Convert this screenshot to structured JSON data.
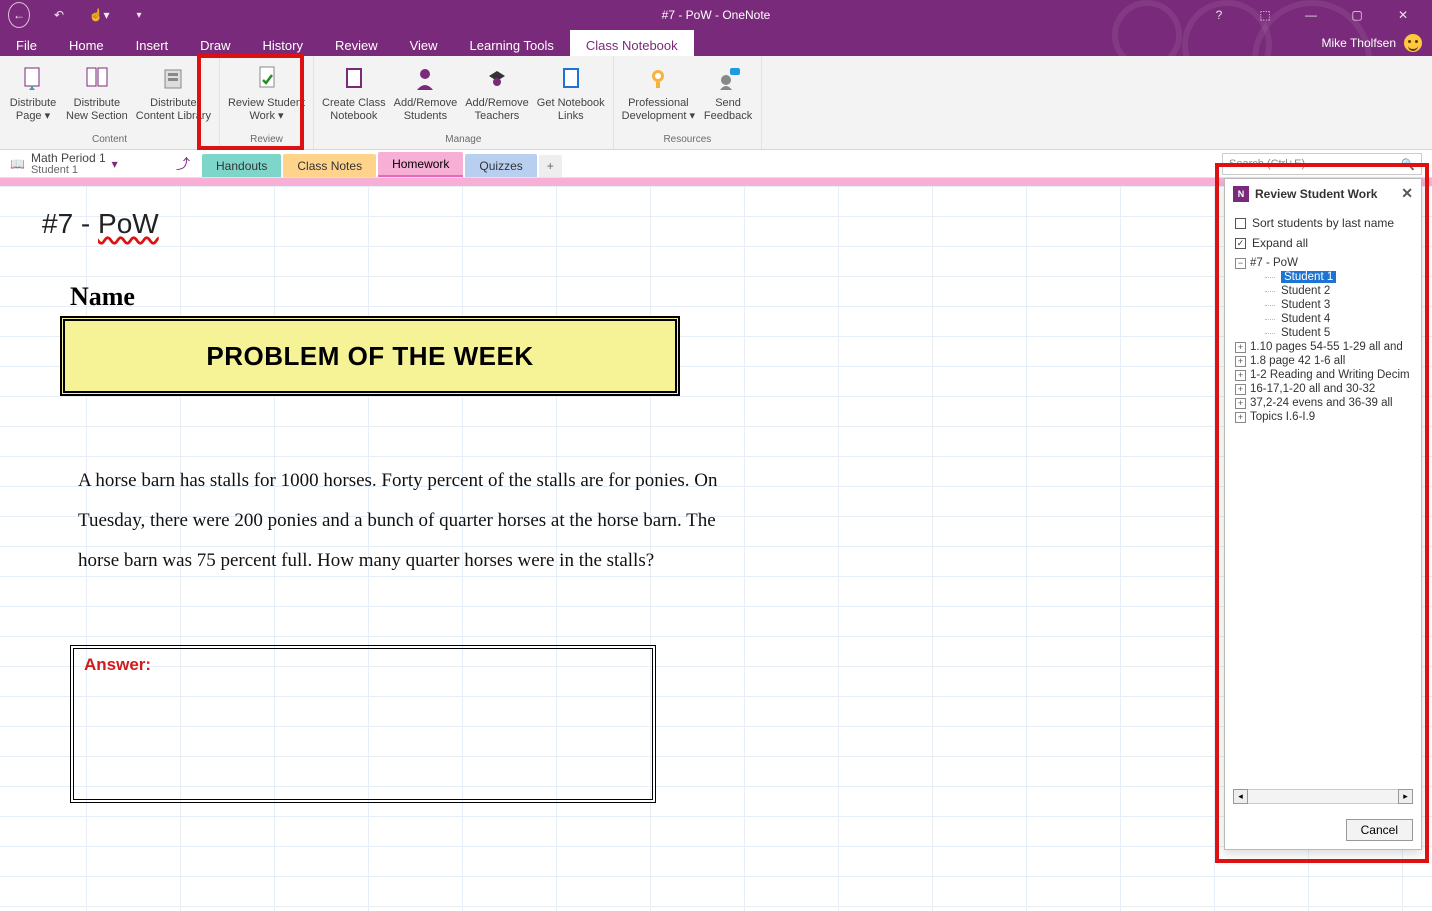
{
  "app": {
    "title": "#7 - PoW - OneNote",
    "user": "Mike Tholfsen"
  },
  "menus": [
    "File",
    "Home",
    "Insert",
    "Draw",
    "History",
    "Review",
    "View",
    "Learning Tools",
    "Class Notebook"
  ],
  "active_menu": 8,
  "ribbon": {
    "groups": [
      {
        "label": "Content",
        "items": [
          {
            "id": "dist-page",
            "label": "Distribute\nPage ▾"
          },
          {
            "id": "dist-section",
            "label": "Distribute\nNew Section"
          },
          {
            "id": "dist-lib",
            "label": "Distribute\nContent Library"
          }
        ]
      },
      {
        "label": "Review",
        "items": [
          {
            "id": "review-work",
            "label": "Review Student\nWork ▾"
          }
        ]
      },
      {
        "label": "Manage",
        "items": [
          {
            "id": "create-nb",
            "label": "Create Class\nNotebook"
          },
          {
            "id": "add-stu",
            "label": "Add/Remove\nStudents"
          },
          {
            "id": "add-tch",
            "label": "Add/Remove\nTeachers"
          },
          {
            "id": "get-links",
            "label": "Get Notebook\nLinks"
          }
        ]
      },
      {
        "label": "Resources",
        "items": [
          {
            "id": "prof-dev",
            "label": "Professional\nDevelopment ▾"
          },
          {
            "id": "send-fb",
            "label": "Send\nFeedback"
          }
        ]
      }
    ]
  },
  "notebook": {
    "name": "Math Period 1",
    "student": "Student 1"
  },
  "sections": [
    {
      "label": "Handouts",
      "cls": "sec-handouts"
    },
    {
      "label": "Class Notes",
      "cls": "sec-class"
    },
    {
      "label": "Homework",
      "cls": "sec-home"
    },
    {
      "label": "Quizzes",
      "cls": "sec-quiz"
    }
  ],
  "search_placeholder": "Search (Ctrl+E)",
  "page": {
    "title_pre": "#7 - ",
    "title_wavy": "PoW",
    "name_label": "Name",
    "pow_heading": "PROBLEM OF THE WEEK",
    "problem": "A horse barn has stalls for 1000 horses. Forty percent of the stalls are for ponies. On Tuesday, there were 200 ponies and a bunch of quarter horses at the horse barn. The horse barn was 75 percent full. How many quarter horses were in the stalls?",
    "answer_label": "Answer:"
  },
  "panel": {
    "title": "Review Student Work",
    "sort_label": "Sort students by last name",
    "expand_label": "Expand all",
    "expanded_page": "#7 - PoW",
    "students": [
      "Student 1",
      "Student 2",
      "Student 3",
      "Student 4",
      "Student 5"
    ],
    "selected_student": 0,
    "other_pages": [
      "1.10 pages 54-55 1-29 all and",
      "1.8 page 42 1-6 all",
      "1-2 Reading and Writing Decim",
      "16-17,1-20 all and 30-32",
      "37,2-24 evens and 36-39 all",
      "Topics I.6-I.9"
    ],
    "cancel": "Cancel"
  }
}
